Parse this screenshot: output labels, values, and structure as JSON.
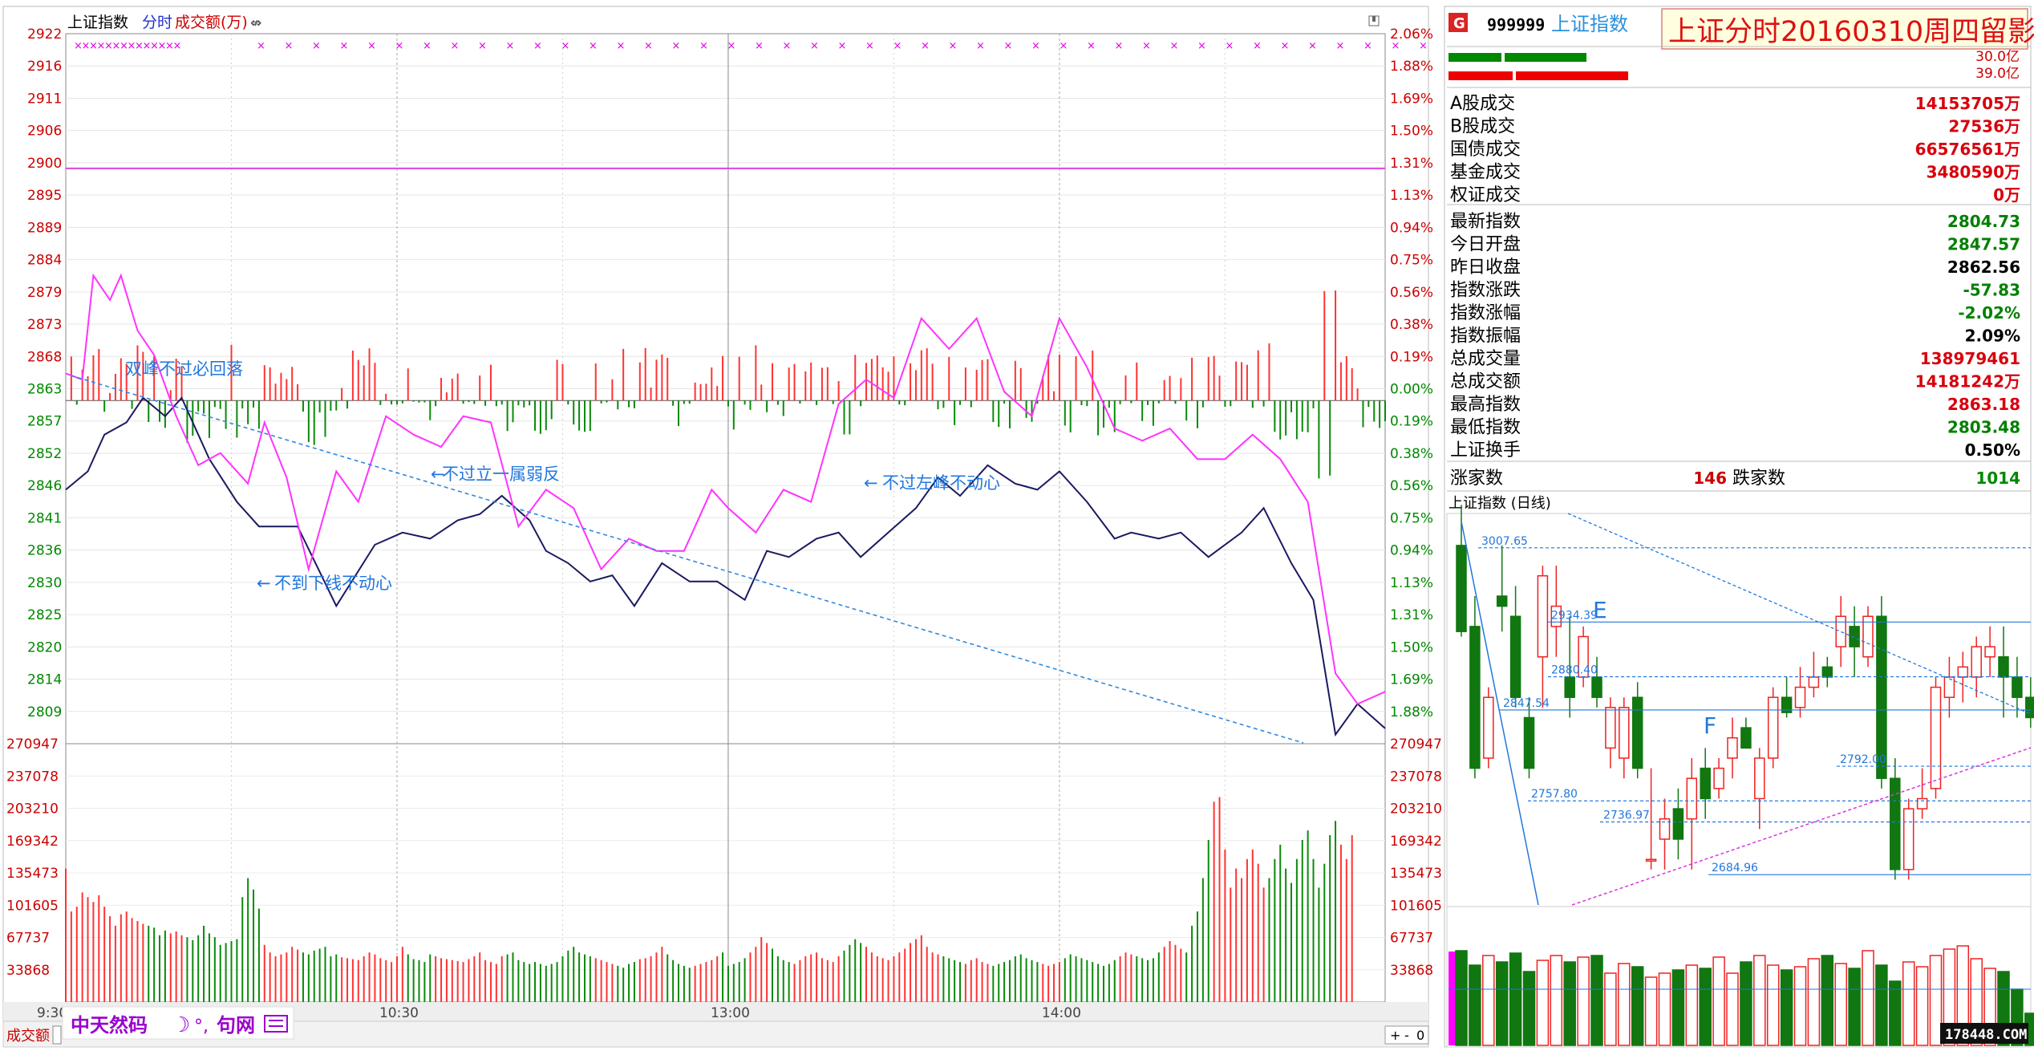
{
  "header": {
    "index_name": "上证指数",
    "tab_timeshare": "分时",
    "tab_volume": "成交额(万)",
    "overlay_title": "上证分时20160310周四留影"
  },
  "right_panel": {
    "badge": "G",
    "code": "999999",
    "name": "上证指数",
    "bar_label_1": "30.0亿",
    "bar_label_2": "39.0亿",
    "stats_group_a": [
      {
        "label": "A股成交",
        "value": "14153705万",
        "color": "#d8000c"
      },
      {
        "label": "B股成交",
        "value": "27536万",
        "color": "#d8000c"
      },
      {
        "label": "国债成交",
        "value": "66576561万",
        "color": "#d8000c"
      },
      {
        "label": "基金成交",
        "value": "3480590万",
        "color": "#d8000c"
      },
      {
        "label": "权证成交",
        "value": "0万",
        "color": "#d8000c"
      }
    ],
    "stats_group_b": [
      {
        "label": "最新指数",
        "value": "2804.73",
        "color": "#008000"
      },
      {
        "label": "今日开盘",
        "value": "2847.57",
        "color": "#008000"
      },
      {
        "label": "昨日收盘",
        "value": "2862.56",
        "color": "#000000"
      },
      {
        "label": "指数涨跌",
        "value": "-57.83",
        "color": "#008000"
      },
      {
        "label": "指数涨幅",
        "value": "-2.02%",
        "color": "#008000"
      },
      {
        "label": "指数振幅",
        "value": "2.09%",
        "color": "#000000"
      },
      {
        "label": "总成交量",
        "value": "138979461",
        "color": "#d8000c"
      },
      {
        "label": "总成交额",
        "value": "14181242万",
        "color": "#d8000c"
      },
      {
        "label": "最高指数",
        "value": "2863.18",
        "color": "#d8000c"
      },
      {
        "label": "最低指数",
        "value": "2803.48",
        "color": "#008000"
      },
      {
        "label": "上证换手",
        "value": "0.50%",
        "color": "#000000"
      }
    ],
    "advance_label": "涨家数",
    "advance_value": "146",
    "decline_label": "跌家数",
    "decline_value": "1014",
    "daily_title": "上证指数 (日线)",
    "watermark": "178448.COM"
  },
  "footer": {
    "volume_tab": "成交额",
    "brand": "中天然码",
    "brand_suffix": "句网",
    "btn_plus": "+",
    "btn_minus": "-",
    "btn_zero": "0"
  },
  "colors": {
    "up": "#ff3333",
    "down": "#0a8a0a",
    "price": "#1a1a60",
    "avg": "#ff33ff",
    "guide": "#2277dd"
  },
  "chart_data": [
    {
      "type": "line",
      "name": "intraday",
      "yaxis_left": [
        "2922",
        "2916",
        "2911",
        "2906",
        "2900",
        "2895",
        "2889",
        "2884",
        "2879",
        "2873",
        "2868",
        "2863",
        "2857",
        "2852",
        "2846",
        "2841",
        "2836",
        "2830",
        "2825",
        "2820",
        "2814",
        "2809"
      ],
      "yaxis_right": [
        "2.06%",
        "1.88%",
        "1.69%",
        "1.50%",
        "1.31%",
        "1.13%",
        "0.94%",
        "0.75%",
        "0.56%",
        "0.38%",
        "0.19%",
        "0.00%",
        "0.19%",
        "0.38%",
        "0.56%",
        "0.75%",
        "0.94%",
        "1.13%",
        "1.31%",
        "1.50%",
        "1.69%",
        "1.88%"
      ],
      "ylim": [
        2806.5,
        2922.5
      ],
      "prev_close": 2862.56,
      "xticks": [
        "9:30",
        "10:30",
        "13:00",
        "14:00"
      ],
      "series": [
        {
          "name": "price",
          "x": [
            0,
            4,
            7,
            11,
            14,
            18,
            21,
            26,
            31,
            35,
            42,
            49,
            56,
            61,
            66,
            71,
            75,
            79,
            84,
            87,
            91,
            95,
            99,
            103,
            108,
            113,
            118,
            123,
            127,
            131,
            136,
            140,
            144,
            149,
            154,
            158,
            162,
            167,
            172,
            176,
            180,
            185,
            190,
            193,
            198,
            202,
            207,
            213,
            217,
            222,
            226,
            230,
            234,
            239
          ],
          "y": [
            2848,
            2851,
            2857,
            2859,
            2863,
            2860,
            2863,
            2853,
            2846,
            2842,
            2842,
            2829,
            2839,
            2841,
            2840,
            2843,
            2844,
            2847,
            2843,
            2838,
            2836,
            2833,
            2834,
            2829,
            2836,
            2833,
            2833,
            2830,
            2838,
            2837,
            2840,
            2841,
            2837,
            2841,
            2845,
            2850,
            2847,
            2852,
            2849,
            2848,
            2851,
            2846,
            2840,
            2841,
            2840,
            2841,
            2837,
            2841,
            2845,
            2836,
            2830,
            2808,
            2813,
            2809
          ]
        },
        {
          "name": "avg",
          "x": [
            0,
            3,
            5,
            8,
            10,
            13,
            16,
            20,
            24,
            28,
            33,
            36,
            40,
            44,
            49,
            53,
            58,
            63,
            68,
            72,
            77,
            82,
            87,
            92,
            97,
            102,
            107,
            112,
            117,
            120,
            125,
            130,
            135,
            140,
            145,
            150,
            155,
            160,
            165,
            170,
            175,
            180,
            185,
            190,
            195,
            200,
            205,
            210,
            215,
            220,
            225,
            230,
            234,
            239
          ],
          "y": [
            2867,
            2866,
            2883,
            2879,
            2883,
            2874,
            2870,
            2860,
            2852,
            2854,
            2849,
            2859,
            2850,
            2835,
            2851,
            2846,
            2860,
            2857,
            2855,
            2860,
            2859,
            2842,
            2848,
            2845,
            2835,
            2840,
            2838,
            2838,
            2848,
            2845,
            2841,
            2848,
            2846,
            2862,
            2866,
            2863,
            2876,
            2871,
            2876,
            2864,
            2860,
            2876,
            2868,
            2858,
            2856,
            2858,
            2853,
            2853,
            2857,
            2853,
            2846,
            2818,
            2813,
            2815
          ]
        }
      ],
      "annotations": [
        "双峰不过必回落",
        "不过立一属弱反",
        "不到下线不动心",
        "不过左峰不动心"
      ]
    },
    {
      "type": "bar",
      "name": "volume",
      "yaxis": [
        "270947",
        "237078",
        "203210",
        "169342",
        "135473",
        "101605",
        "67737",
        "33868"
      ],
      "ylim": [
        0,
        270947
      ],
      "values": [
        140000,
        95000,
        100000,
        115000,
        110000,
        105000,
        112000,
        100000,
        90000,
        80000,
        92000,
        95000,
        88000,
        85000,
        82000,
        80000,
        78000,
        70000,
        75000,
        72000,
        74000,
        70000,
        68000,
        65000,
        70000,
        80000,
        72000,
        68000,
        60000,
        62000,
        64000,
        66000,
        110000,
        130000,
        118000,
        98000,
        60000,
        52000,
        48000,
        50000,
        52000,
        58000,
        55000,
        52000,
        50000,
        54000,
        56000,
        58000,
        48000,
        50000,
        47000,
        46000,
        45000,
        44000,
        48000,
        52000,
        50000,
        46000,
        44000,
        42000,
        48000,
        58000,
        50000,
        45000,
        44000,
        42000,
        50000,
        48000,
        46000,
        45000,
        44000,
        43000,
        42000,
        45000,
        48000,
        52000,
        44000,
        42000,
        40000,
        48000,
        50000,
        52000,
        44000,
        42000,
        40000,
        42000,
        40000,
        38000,
        40000,
        42000,
        48000,
        54000,
        58000,
        52000,
        50000,
        48000,
        46000,
        44000,
        42000,
        40000,
        38000,
        36000,
        40000,
        42000,
        45000,
        46000,
        48000,
        52000,
        58000,
        50000,
        44000,
        40000,
        38000,
        36000,
        38000,
        40000,
        42000,
        44000,
        48000,
        52000,
        38000,
        40000,
        42000,
        46000,
        52000,
        58000,
        68000,
        62000,
        56000,
        48000,
        44000,
        42000,
        40000,
        44000,
        48000,
        50000,
        52000,
        46000,
        44000,
        42000,
        48000,
        54000,
        60000,
        66000,
        62000,
        58000,
        52000,
        48000,
        46000,
        44000,
        48000,
        52000,
        56000,
        62000,
        66000,
        70000,
        58000,
        52000,
        50000,
        48000,
        46000,
        44000,
        42000,
        40000,
        44000,
        46000,
        42000,
        40000,
        38000,
        40000,
        42000,
        44000,
        48000,
        50000,
        46000,
        44000,
        42000,
        40000,
        38000,
        40000,
        42000,
        46000,
        50000,
        48000,
        46000,
        44000,
        42000,
        40000,
        38000,
        40000,
        44000,
        48000,
        52000,
        50000,
        48000,
        46000,
        44000,
        46000,
        52000,
        58000,
        64000,
        60000,
        56000,
        52000,
        80000,
        95000,
        130000,
        170000,
        210000,
        215000,
        160000,
        120000,
        140000,
        130000,
        150000,
        160000,
        145000,
        120000,
        130000,
        150000,
        165000,
        140000,
        125000,
        150000,
        170000,
        180000,
        150000,
        120000,
        145000,
        175000,
        190000,
        165000,
        150000,
        175000
      ]
    },
    {
      "type": "candlestick",
      "name": "daily",
      "level_labels": [
        "3007.65",
        "2934.39",
        "2880.40",
        "2847.54",
        "2757.80",
        "2736.97",
        "2684.96",
        "2792.00"
      ],
      "markers": [
        "E",
        "F"
      ]
    }
  ]
}
